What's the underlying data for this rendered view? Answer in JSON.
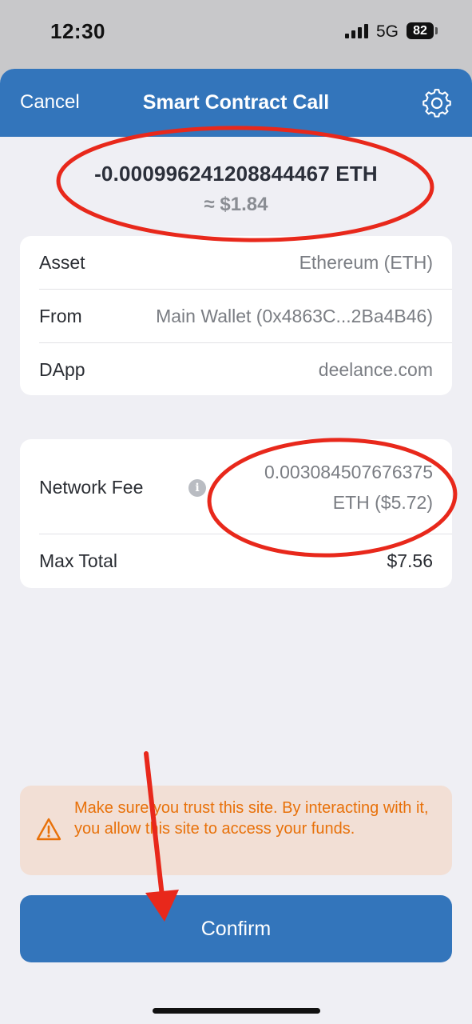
{
  "status_bar": {
    "time": "12:30",
    "network": "5G",
    "battery": "82"
  },
  "nav": {
    "cancel_label": "Cancel",
    "title": "Smart Contract Call",
    "settings_icon": "gear-icon"
  },
  "amount": {
    "value": "-0.000996241208844467 ETH",
    "usd": "≈ $1.84"
  },
  "details": [
    {
      "label": "Asset",
      "value": "Ethereum (ETH)"
    },
    {
      "label": "From",
      "value": "Main Wallet (0x4863C...2Ba4B46)"
    },
    {
      "label": "DApp",
      "value": "deelance.com"
    }
  ],
  "fees": {
    "network_fee_label": "Network Fee",
    "network_fee_value_line1": "0.003084507676375",
    "network_fee_value_line2": "ETH ($5.72)",
    "info_icon": "info-icon",
    "max_total_label": "Max Total",
    "max_total_value": "$7.56"
  },
  "warning": {
    "icon": "warning-icon",
    "text": "Make sure you trust this site. By interacting with it, you allow this site to access your funds."
  },
  "confirm_label": "Confirm",
  "colors": {
    "accent": "#3375bb",
    "warning_bg": "#f2dfd5",
    "warning_text": "#e8710a",
    "annotation": "#e8281b"
  }
}
